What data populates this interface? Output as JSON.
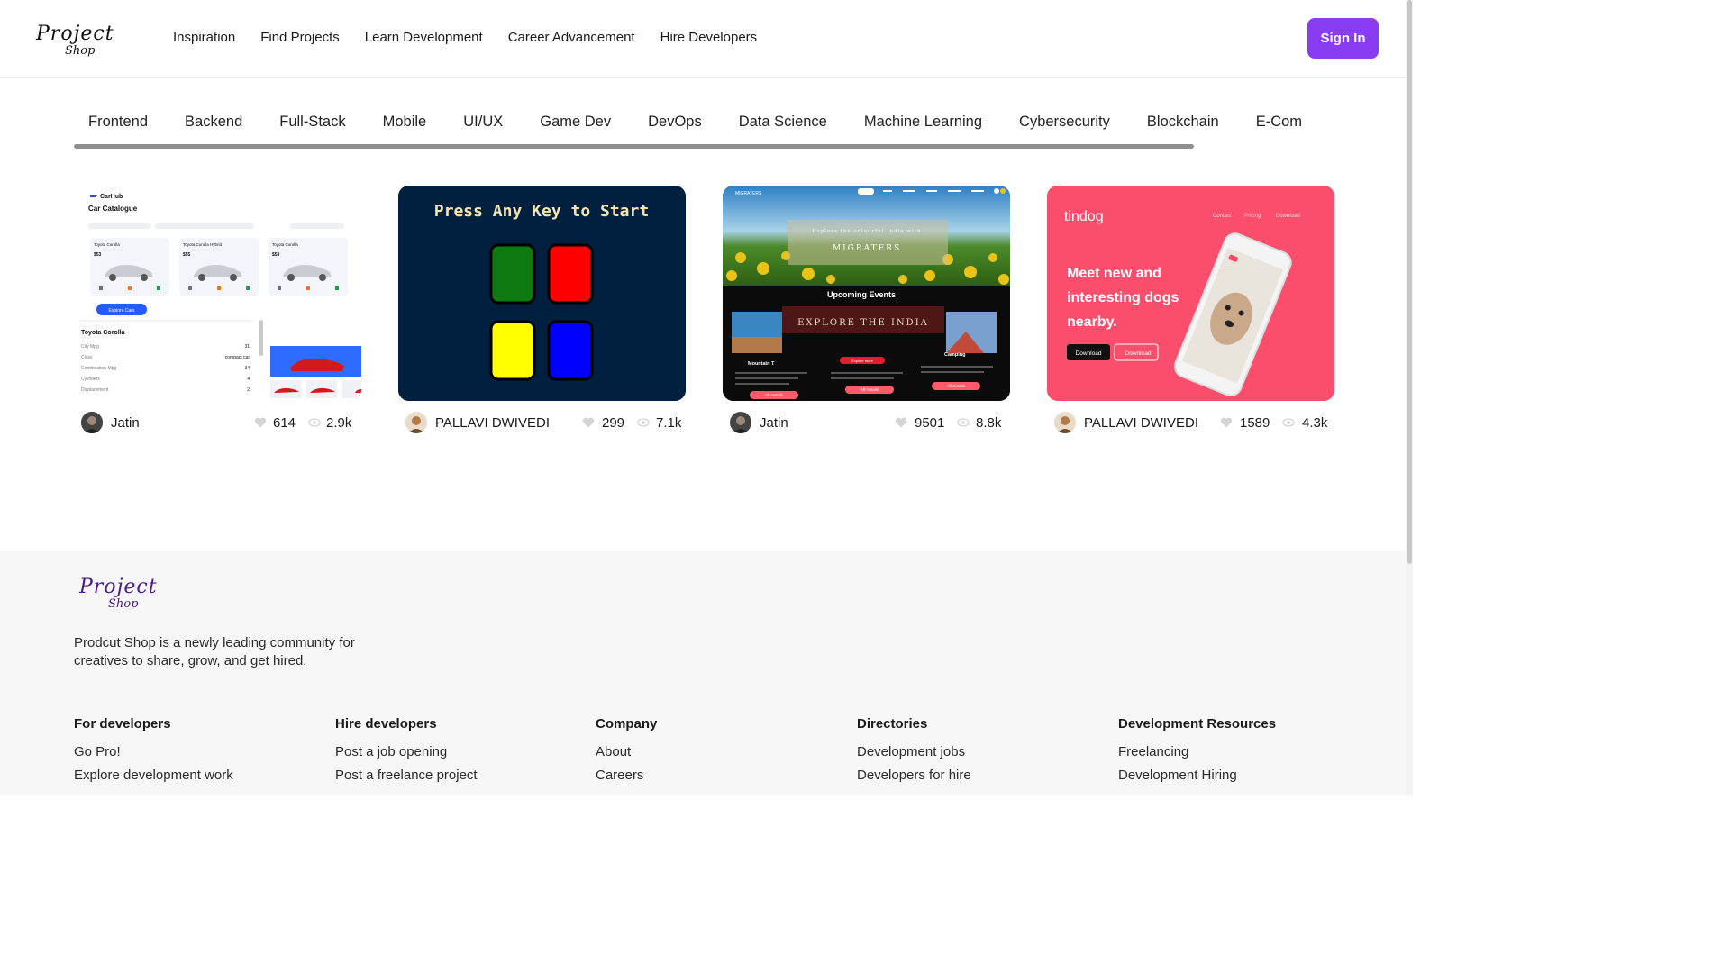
{
  "brand": {
    "logo_line1": "Project",
    "logo_line2": "Shop"
  },
  "header": {
    "nav": [
      "Inspiration",
      "Find Projects",
      "Learn Development",
      "Career Advancement",
      "Hire Developers"
    ],
    "signin_label": "Sign In"
  },
  "categories": [
    "Frontend",
    "Backend",
    "Full-Stack",
    "Mobile",
    "UI/UX",
    "Game Dev",
    "DevOps",
    "Data Science",
    "Machine Learning",
    "Cybersecurity",
    "Blockchain",
    "E-Com"
  ],
  "projects": [
    {
      "author": "Jatin",
      "likes": "614",
      "views": "2.9k",
      "preview": {
        "brand": "CarHub",
        "title": "Car Catalogue",
        "cars": [
          "Toyota Corolla",
          "Toyota Corolla Hybrid",
          "Toyota Corolla"
        ],
        "prices": [
          "$53",
          "$55",
          "$53"
        ],
        "button": "Explore Cars",
        "detail_title": "Toyota Corolla",
        "specs": [
          [
            "City Mpg",
            "31"
          ],
          [
            "Class",
            "compact car"
          ],
          [
            "Combination Mpg",
            "34"
          ],
          [
            "Cylinders",
            "4"
          ],
          [
            "Displacement",
            "2"
          ]
        ]
      }
    },
    {
      "author": "PALLAVI DWIVEDI",
      "likes": "299",
      "views": "7.1k",
      "preview": {
        "title": "Press Any Key to Start"
      }
    },
    {
      "author": "Jatin",
      "likes": "9501",
      "views": "8.8k",
      "preview": {
        "nav_brand": "MIGRATERS",
        "hero_small": "Explore the colourful India with",
        "hero_title": "MIGRATERS",
        "section": "Upcoming Events",
        "banner": "EXPLORE THE INDIA",
        "left_caption": "Mountain T",
        "right_caption": "Camping",
        "cta": "Explore more",
        "button": "All Details"
      }
    },
    {
      "author": "PALLAVI DWIVEDI",
      "likes": "1589",
      "views": "4.3k",
      "preview": {
        "brand": "tindog",
        "links": [
          "Contact",
          "Pricing",
          "Download"
        ],
        "headline_1": "Meet new and",
        "headline_2": "interesting dogs",
        "headline_3": "nearby.",
        "btn1": "Download",
        "btn2": "Download"
      }
    }
  ],
  "footer": {
    "tagline": "Prodcut Shop is a newly leading community for creatives to share, grow, and get hired.",
    "columns": [
      {
        "title": "For developers",
        "links": [
          "Go Pro!",
          "Explore development work"
        ]
      },
      {
        "title": "Hire developers",
        "links": [
          "Post a job opening",
          "Post a freelance project"
        ]
      },
      {
        "title": "Company",
        "links": [
          "About",
          "Careers"
        ]
      },
      {
        "title": "Directories",
        "links": [
          "Development jobs",
          "Developers for hire"
        ]
      },
      {
        "title": "Development Resources",
        "links": [
          "Freelancing",
          "Development Hiring"
        ]
      }
    ]
  },
  "colors": {
    "accent": "#8a3cf2",
    "footer_bg": "#f7f7f7",
    "tindog": "#fb4e6c",
    "game_bg": "#01203f"
  }
}
